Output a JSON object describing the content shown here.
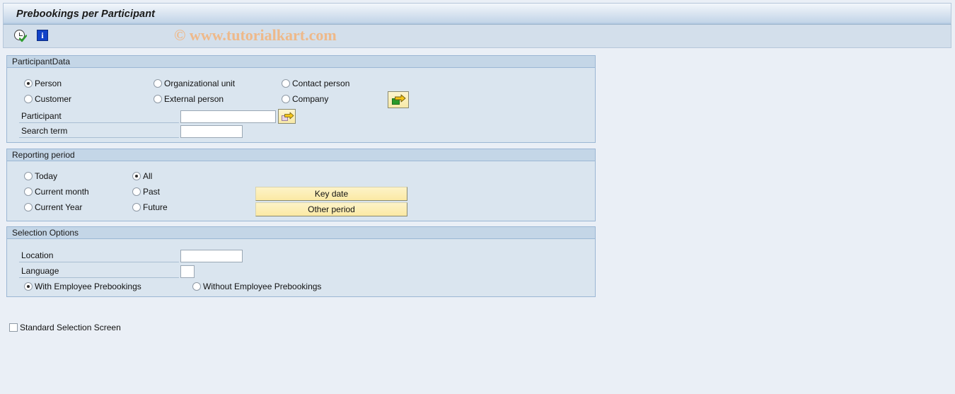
{
  "window": {
    "title": "Prebookings per Participant"
  },
  "toolbar": {
    "items": [
      {
        "icon": "clock-check-icon",
        "name": "execute-icon"
      },
      {
        "icon": "info-icon",
        "glyph": "i",
        "name": "information-icon"
      }
    ]
  },
  "watermark": {
    "text": "© www.tutorialkart.com",
    "color": "#eeb98a"
  },
  "participant_panel": {
    "title": "ParticipantData",
    "radios": [
      {
        "label": "Person",
        "checked": true
      },
      {
        "label": "Organizational unit",
        "checked": false
      },
      {
        "label": "Contact person",
        "checked": false
      },
      {
        "label": "Customer",
        "checked": false
      },
      {
        "label": "External person",
        "checked": false
      },
      {
        "label": "Company",
        "checked": false
      }
    ],
    "fields": [
      {
        "label": "Participant",
        "value": "",
        "placeholder": ""
      },
      {
        "label": "Search term",
        "value": "",
        "placeholder": ""
      }
    ],
    "buttons": {
      "entity_select": "entity-select-button",
      "participant_search": "participant-value-help-button"
    }
  },
  "reporting_panel": {
    "title": "Reporting period",
    "radios_col1": [
      {
        "label": "Today",
        "checked": false
      },
      {
        "label": "Current month",
        "checked": false
      },
      {
        "label": "Current Year",
        "checked": false
      }
    ],
    "radios_col2": [
      {
        "label": "All",
        "checked": true
      },
      {
        "label": "Past",
        "checked": false
      },
      {
        "label": "Future",
        "checked": false
      }
    ],
    "buttons": [
      {
        "label": "Key date"
      },
      {
        "label": "Other period"
      }
    ]
  },
  "selection_panel": {
    "title": "Selection Options",
    "fields": [
      {
        "label": "Location",
        "value": "",
        "placeholder": ""
      },
      {
        "label": "Language",
        "value": "",
        "placeholder": ""
      }
    ],
    "radios": [
      {
        "label": "With Employee Prebookings",
        "checked": true
      },
      {
        "label": "Without Employee Prebookings",
        "checked": false
      }
    ]
  },
  "footer": {
    "standard_selection_screen": {
      "label": "Standard Selection Screen",
      "checked": false
    }
  },
  "colors": {
    "panel_bg": "#dae5ef",
    "panel_header": "#c4d6e7",
    "page_bg": "#eaeff6",
    "button_yellow": "#fbe9a4",
    "border": "#9bb7d4"
  }
}
